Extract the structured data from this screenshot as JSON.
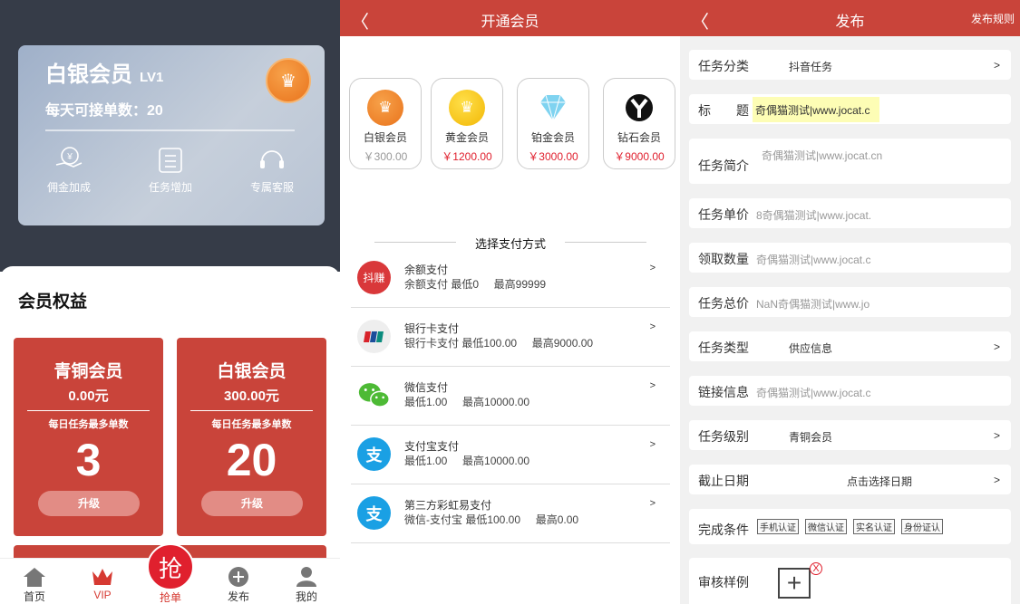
{
  "vip": {
    "card": {
      "level_name": "白银会员",
      "level_tag": "LV1",
      "daily_label": "每天可接单数：20"
    },
    "perks": [
      {
        "label": "佣金加成"
      },
      {
        "label": "任务增加"
      },
      {
        "label": "专属客服"
      }
    ],
    "section_title": "会员权益",
    "tiers": [
      {
        "name": "青铜会员",
        "price": "0.00元",
        "sub": "每日任务最多单数",
        "count": "3",
        "button": "升级"
      },
      {
        "name": "白银会员",
        "price": "300.00元",
        "sub": "每日任务最多单数",
        "count": "20",
        "button": "升级"
      }
    ],
    "tabs": [
      {
        "label": "首页"
      },
      {
        "label": "VIP"
      },
      {
        "label": "抢单"
      },
      {
        "label": "发布"
      },
      {
        "label": "我的"
      }
    ],
    "grab_char": "抢"
  },
  "membership": {
    "title": "开通会员",
    "levels": [
      {
        "name": "白银会员",
        "price": "￥300.00"
      },
      {
        "name": "黄金会员",
        "price": "￥1200.00"
      },
      {
        "name": "铂金会员",
        "price": "￥3000.00"
      },
      {
        "name": "钻石会员",
        "price": "￥9000.00"
      }
    ],
    "pay_title": "选择支付方式",
    "payments": [
      {
        "name": "余额支付",
        "detail": "余额支付 最低0     最高99999",
        "icon": "douzhuan-icon",
        "icon_text": "抖赚"
      },
      {
        "name": "银行卡支付",
        "detail": "银行卡支付 最低100.00     最高9000.00",
        "icon": "unionpay-icon",
        "icon_text": ""
      },
      {
        "name": "微信支付",
        "detail": "最低1.00     最高10000.00",
        "icon": "wechat-icon",
        "icon_text": ""
      },
      {
        "name": "支付宝支付",
        "detail": "最低1.00     最高10000.00",
        "icon": "alipay-icon",
        "icon_text": "支"
      },
      {
        "name": "第三方彩虹易支付",
        "detail": "微信-支付宝 最低100.00     最高0.00",
        "icon": "alipay-icon",
        "icon_text": "支"
      }
    ],
    "chevron": ">"
  },
  "publish": {
    "title": "发布",
    "rules": "发布规则",
    "fields": {
      "category": {
        "label": "任务分类",
        "value": "抖音任务"
      },
      "title": {
        "label_a": "标",
        "label_b": "题",
        "value": "奇偶猫测试|www.jocat.c"
      },
      "intro": {
        "label": "任务简介",
        "placeholder": "奇偶猫测试|www.jocat.cn"
      },
      "unit_price": {
        "label": "任务单价",
        "placeholder": "8奇偶猫测试|www.jocat."
      },
      "quantity": {
        "label": "领取数量",
        "placeholder": "奇偶猫测试|www.jocat.c"
      },
      "total": {
        "label": "任务总价",
        "placeholder": "NaN奇偶猫测试|www.jo"
      },
      "type": {
        "label": "任务类型",
        "value": "供应信息"
      },
      "link": {
        "label": "链接信息",
        "placeholder": "奇偶猫测试|www.jocat.c"
      },
      "level": {
        "label": "任务级别",
        "value": "青铜会员"
      },
      "deadline": {
        "label": "截止日期",
        "value": "点击选择日期"
      },
      "conditions": {
        "label": "完成条件",
        "options": [
          "手机认证",
          "微信认证",
          "实名认证",
          "身份证认"
        ]
      },
      "sample": {
        "label": "审核样例",
        "remove": "X"
      }
    },
    "chevron": ">"
  },
  "back_glyph": "〈"
}
